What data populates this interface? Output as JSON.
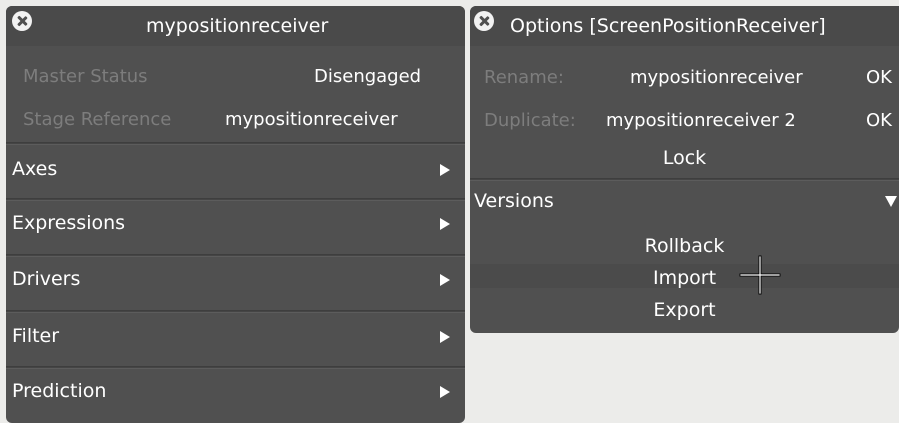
{
  "left_panel": {
    "title": "mypositionreceiver",
    "master_status": {
      "label": "Master Status",
      "value": "Disengaged"
    },
    "stage_reference": {
      "label": "Stage Reference",
      "value": "mypositionreceiver"
    },
    "menu_items": [
      {
        "label": "Axes"
      },
      {
        "label": "Expressions"
      },
      {
        "label": "Drivers"
      },
      {
        "label": "Filter"
      },
      {
        "label": "Prediction"
      }
    ]
  },
  "right_panel": {
    "title": "Options [ScreenPositionReceiver]",
    "rename": {
      "label": "Rename:",
      "value": "mypositionreceiver",
      "ok": "OK"
    },
    "duplicate": {
      "label": "Duplicate:",
      "value": "mypositionreceiver 2",
      "ok": "OK"
    },
    "lock_label": "Lock",
    "versions": {
      "label": "Versions",
      "items": [
        "Rollback",
        "Import",
        "Export"
      ]
    }
  },
  "icons": {
    "close": "close-icon",
    "expand": "triangle-right-icon",
    "collapse": "triangle-down-icon",
    "cursor": "crosshair-cursor-icon"
  }
}
